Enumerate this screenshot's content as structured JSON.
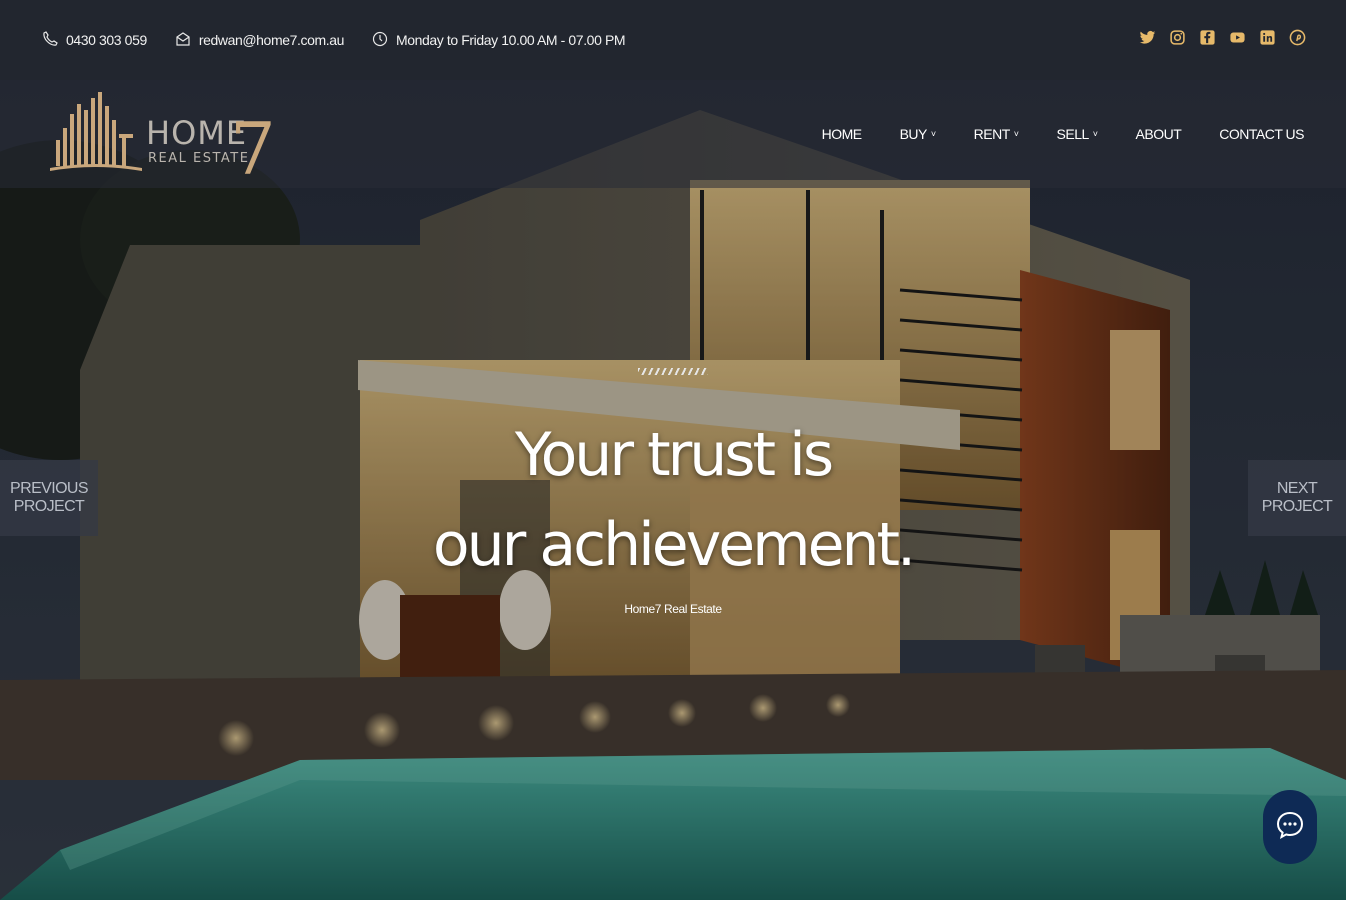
{
  "topbar": {
    "phone": "0430 303 059",
    "email": "redwan@home7.com.au",
    "hours": "Monday to Friday 10.00 AM - 07.00 PM",
    "social_icons": [
      "twitter-icon",
      "instagram-icon",
      "facebook-icon",
      "youtube-icon",
      "linkedin-icon",
      "pinterest-icon"
    ]
  },
  "logo": {
    "word": "HOME",
    "number": "7",
    "tagline": "REAL ESTATE"
  },
  "nav": {
    "items": [
      {
        "label": "HOME",
        "dropdown": false
      },
      {
        "label": "BUY",
        "dropdown": true
      },
      {
        "label": "RENT",
        "dropdown": true
      },
      {
        "label": "SELL",
        "dropdown": true
      },
      {
        "label": "ABOUT",
        "dropdown": false
      },
      {
        "label": "CONTACT US",
        "dropdown": false
      }
    ]
  },
  "hero": {
    "headline_line1": "Your trust is",
    "headline_line2": "our achievement.",
    "subline": "Home7 Real Estate",
    "prev_line1": "PREVIOUS",
    "prev_line2": "PROJECT",
    "next_line1": "NEXT",
    "next_line2": "PROJECT"
  },
  "chat": {
    "icon": "chat-bubble-icon"
  },
  "colors": {
    "topbar": "#22262f",
    "accent_logo": "#c9a77c",
    "chat_button": "#0e2a55",
    "pool": "#3fa79a"
  }
}
